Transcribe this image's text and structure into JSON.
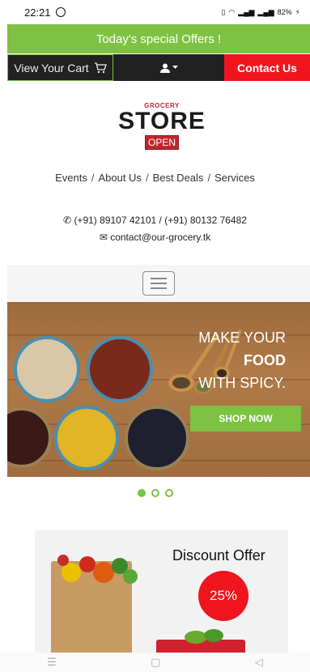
{
  "status_bar": {
    "time": "22:21",
    "battery": "82%"
  },
  "offer_banner": {
    "text": "Today's special Offers !"
  },
  "top_nav": {
    "cart_label": "View Your Cart",
    "contact_label": "Contact Us"
  },
  "logo": {
    "top_text": "GROCERY",
    "main_text": "STORE",
    "sign_text": "OPEN"
  },
  "nav_links": [
    "Events",
    "About Us",
    "Best Deals",
    "Services"
  ],
  "contact": {
    "phone": "(+91) 89107 42101 / (+91) 80132 76482",
    "email": "contact@our-grocery.tk"
  },
  "hero": {
    "line1": "MAKE YOUR",
    "line2": "FOOD",
    "line3": "WITH SPICY.",
    "button": "SHOP NOW",
    "active_slide": 1,
    "slide_count": 3
  },
  "discount": {
    "title": "Discount Offer",
    "badge": "25%"
  },
  "colors": {
    "accent_green": "#7dc242",
    "accent_red": "#f0141e",
    "nav_dark": "#212121"
  }
}
